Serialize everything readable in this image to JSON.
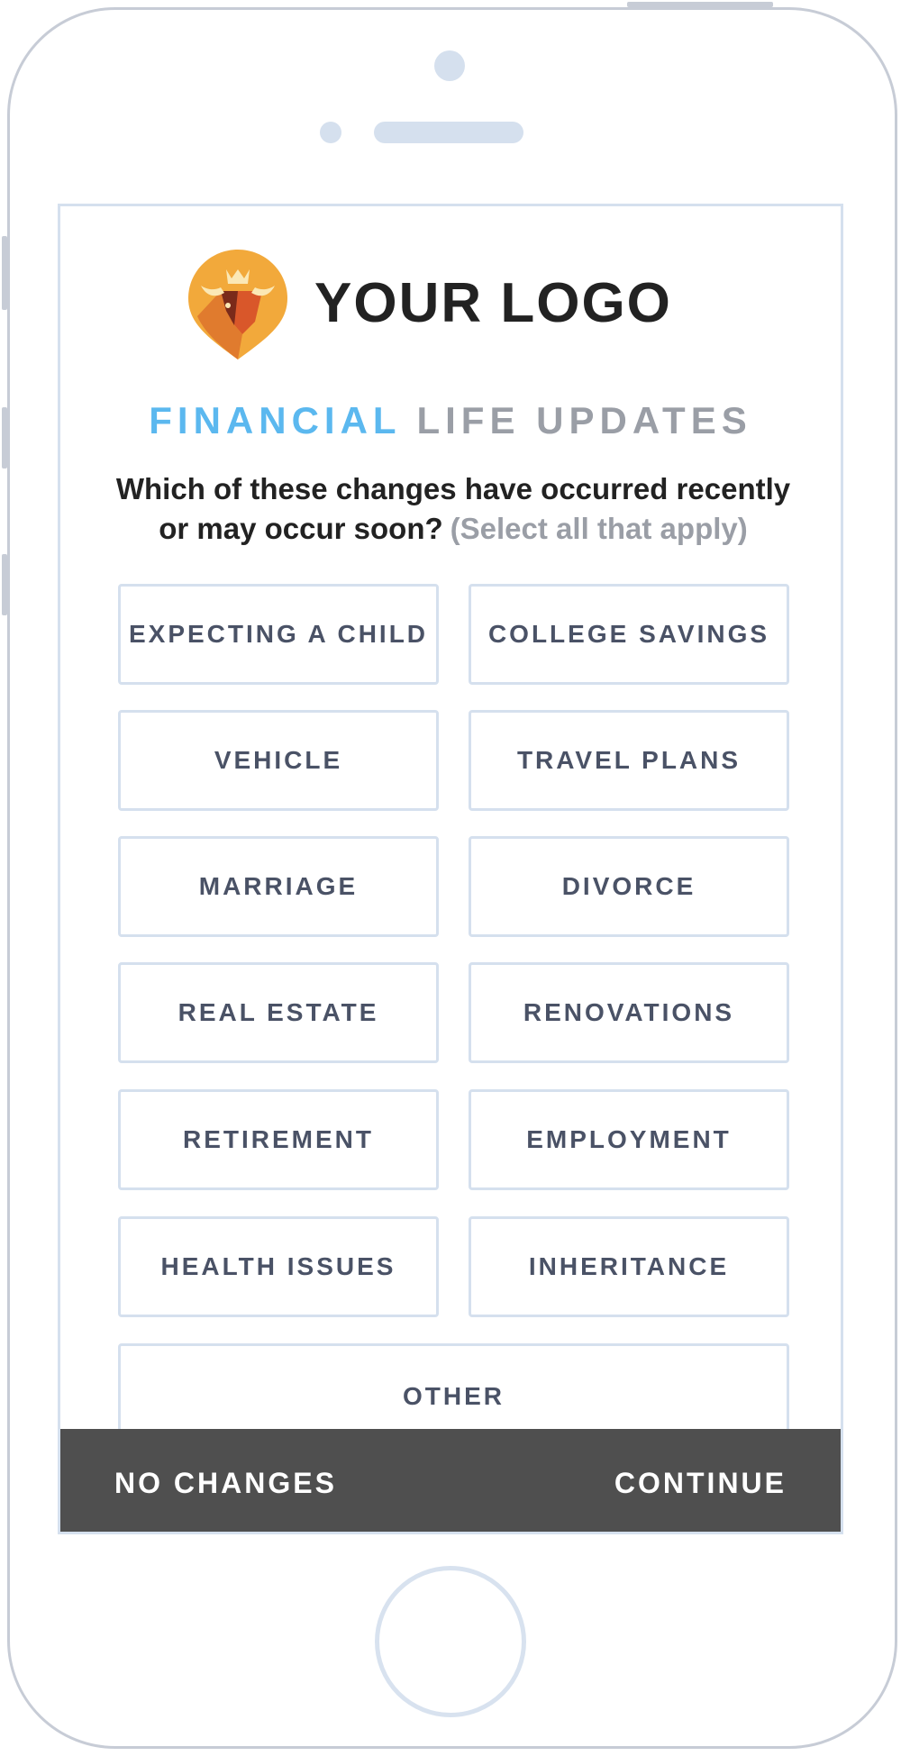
{
  "logo": {
    "text": "YOUR LOGO",
    "colors": {
      "orange": "#f2a93b",
      "dark_orange": "#d9572a",
      "maroon": "#7a2a1a",
      "cream": "#fbe8b5"
    }
  },
  "header": {
    "title_accent": "FINANCIAL",
    "title_rest": "LIFE UPDATES"
  },
  "question": {
    "line1": "Which of these changes have occurred recently",
    "line2": "or may occur soon?",
    "hint": "(Select all that apply)"
  },
  "options": [
    {
      "label": "EXPECTING A CHILD"
    },
    {
      "label": "COLLEGE SAVINGS"
    },
    {
      "label": "VEHICLE"
    },
    {
      "label": "TRAVEL PLANS"
    },
    {
      "label": "MARRIAGE"
    },
    {
      "label": "DIVORCE"
    },
    {
      "label": "REAL ESTATE"
    },
    {
      "label": "RENOVATIONS"
    },
    {
      "label": "RETIREMENT"
    },
    {
      "label": "EMPLOYMENT"
    },
    {
      "label": "HEALTH ISSUES"
    },
    {
      "label": "INHERITANCE"
    },
    {
      "label": "OTHER"
    }
  ],
  "actions": {
    "left_label": "NO CHANGES",
    "right_label": "CONTINUE"
  },
  "colors": {
    "accent": "#5bb8ef",
    "muted_text": "#9a9ea6",
    "option_text": "#4a5266",
    "option_border": "#d5e0ee",
    "action_bar": "#4f4f4f",
    "frame": "#c7ccd6"
  }
}
